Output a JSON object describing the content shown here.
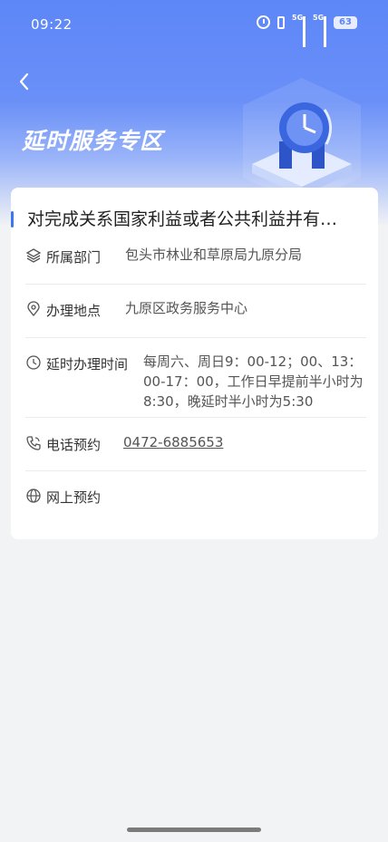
{
  "status_bar": {
    "time": "09:22",
    "network_a": "5G",
    "network_b": "5G",
    "battery": "63"
  },
  "header": {
    "back_icon": "chevron-left-icon",
    "title": "延时服务专区"
  },
  "card": {
    "title": "对完成关系国家利益或者公共利益并有…",
    "accent_color": "#3b78f0",
    "rows": [
      {
        "icon": "layers-icon",
        "label": "所属部门",
        "value": "包头市林业和草原局九原分局"
      },
      {
        "icon": "location-pin-icon",
        "label": "办理地点",
        "value": "九原区政务服务中心"
      },
      {
        "icon": "clock-icon",
        "label": "延时办理时间",
        "value_lines": [
          "每周六、周日9：00-12；00、13：",
          "00-17：00，工作日早提前半小时为",
          "8:30，晚延时半小时为5:30"
        ]
      },
      {
        "icon": "phone-icon",
        "label": "电话预约",
        "value": "0472-6885653"
      },
      {
        "icon": "globe-icon",
        "label": "网上预约",
        "value": ""
      }
    ]
  },
  "colors": {
    "hero_blue": "#5d86f7",
    "link": "#1a28b8",
    "background": "#f2f3f5"
  }
}
